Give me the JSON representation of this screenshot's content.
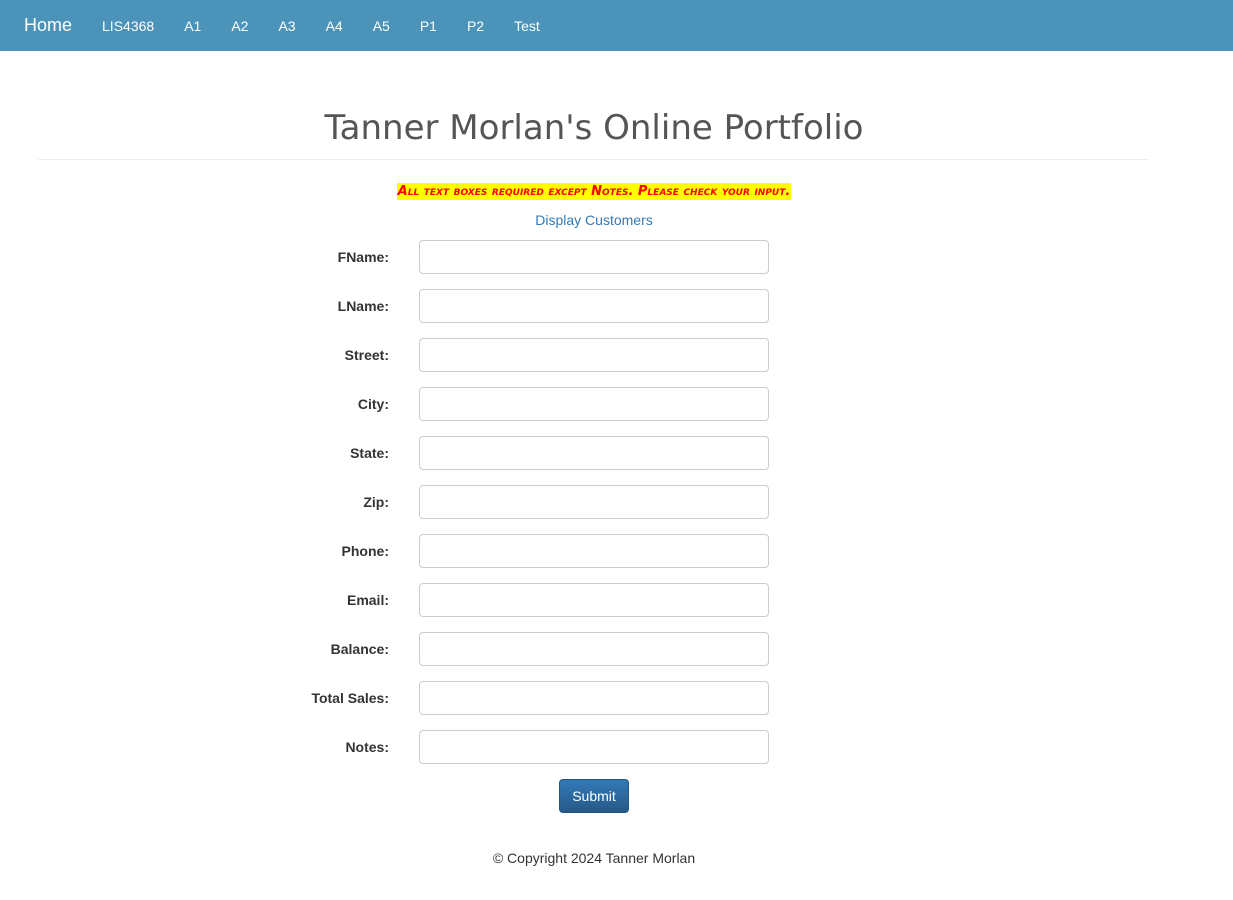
{
  "nav": {
    "brand": "Home",
    "links": [
      "LIS4368",
      "A1",
      "A2",
      "A3",
      "A4",
      "A5",
      "P1",
      "P2",
      "Test"
    ]
  },
  "header": {
    "title": "Tanner Morlan's Online Portfolio"
  },
  "warning": "All text boxes required except Notes. Please check your input.",
  "display_link": "Display Customers",
  "form": {
    "fields": [
      {
        "label": "FName:",
        "value": ""
      },
      {
        "label": "LName:",
        "value": ""
      },
      {
        "label": "Street:",
        "value": ""
      },
      {
        "label": "City:",
        "value": ""
      },
      {
        "label": "State:",
        "value": ""
      },
      {
        "label": "Zip:",
        "value": ""
      },
      {
        "label": "Phone:",
        "value": ""
      },
      {
        "label": "Email:",
        "value": ""
      },
      {
        "label": "Balance:",
        "value": ""
      },
      {
        "label": "Total Sales:",
        "value": ""
      },
      {
        "label": "Notes:",
        "value": ""
      }
    ],
    "submit_label": "Submit"
  },
  "footer": "© Copyright 2024 Tanner Morlan",
  "colors": {
    "navbar": "#4b93b8",
    "link": "#337ab7",
    "warning_bg": "#ffff00",
    "warning_text": "#ff0000"
  }
}
